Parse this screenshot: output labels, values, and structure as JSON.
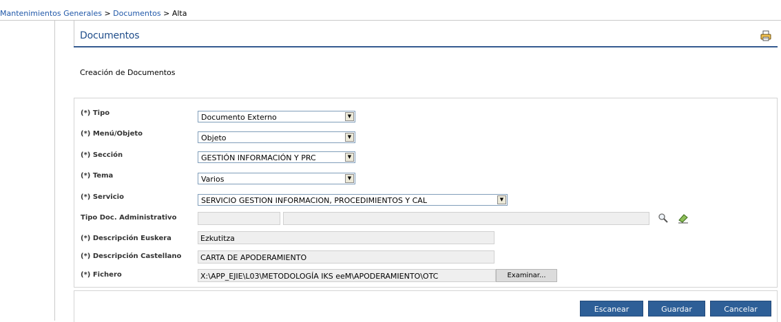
{
  "breadcrumb": {
    "item1": "Mantenimientos Generales",
    "sep1": " > ",
    "item2": "Documentos",
    "sep2": " > ",
    "current": "Alta"
  },
  "header": {
    "title": "Documentos",
    "print_icon": "printer-icon"
  },
  "subtitle": "Creación de Documentos",
  "form": {
    "tipo": {
      "label": "(*) Tipo",
      "value": "Documento Externo"
    },
    "menu_objeto": {
      "label": "(*) Menú/Objeto",
      "value": "Objeto"
    },
    "seccion": {
      "label": "(*) Sección",
      "value": "GESTIÓN INFORMACIÓN Y PRC"
    },
    "tema": {
      "label": "(*) Tema",
      "value": "Varios"
    },
    "servicio": {
      "label": "(*) Servicio",
      "value": "SERVICIO GESTION INFORMACION, PROCEDIMIENTOS Y CAL"
    },
    "tipo_doc_admin": {
      "label": "Tipo Doc. Administrativo",
      "code": "",
      "description": "",
      "search_icon": "magnifier-icon",
      "clear_icon": "eraser-icon"
    },
    "desc_euskera": {
      "label": "(*) Descripción Euskera",
      "value": "Ezkutitza"
    },
    "desc_castellano": {
      "label": "(*) Descripción Castellano",
      "value": "CARTA DE APODERAMIENTO"
    },
    "fichero": {
      "label": "(*) Fichero",
      "value": "X:\\APP_EJIE\\L03\\METODOLOGÍA IKS eeM\\APODERAMIENTO\\OTC",
      "browse": "Examinar..."
    }
  },
  "actions": {
    "scan": "Escanear",
    "save": "Guardar",
    "cancel": "Cancelar"
  },
  "colors": {
    "link": "#1f57a8",
    "title": "#1f4d8a",
    "button": "#2e5f97"
  }
}
